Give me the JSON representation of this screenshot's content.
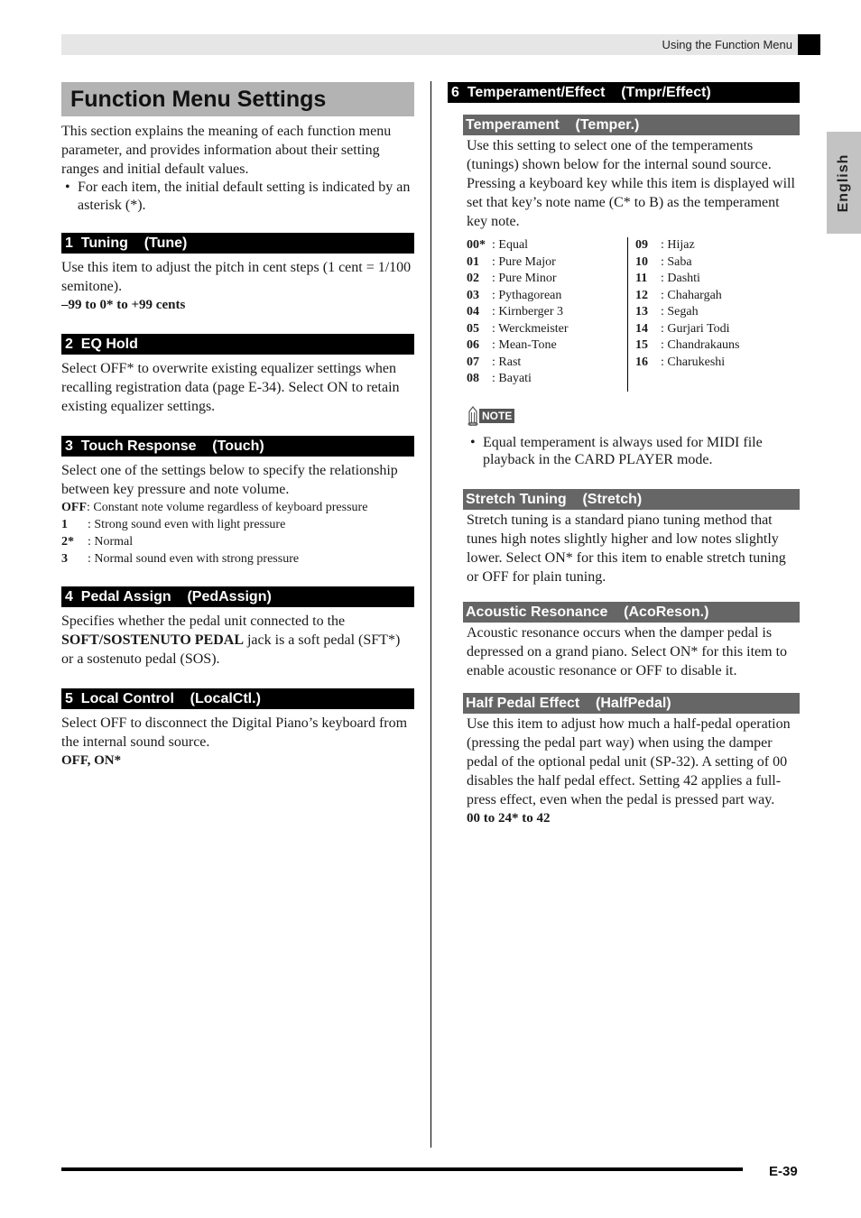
{
  "header": {
    "running_title": "Using the Function Menu"
  },
  "language_tab": "English",
  "page_title": "Function Menu Settings",
  "intro": {
    "paragraph": "This section explains the meaning of each function menu parameter, and provides information about their setting ranges and initial default values.",
    "bullet": "For each item, the initial default setting is indicated by an asterisk (*)."
  },
  "sections": {
    "tuning": {
      "heading": "1  Tuning    (Tune)",
      "body": "Use this item to adjust the pitch in cent steps (1 cent = 1/100 semitone).",
      "range": "–99 to 0* to +99 cents"
    },
    "eq_hold": {
      "heading": "2  EQ Hold",
      "body": "Select OFF* to overwrite existing equalizer settings when recalling registration data (page E-34). Select ON to retain existing equalizer settings."
    },
    "touch": {
      "heading": "3  Touch Response    (Touch)",
      "body": "Select one of the settings below to specify the relationship between key pressure and note volume.",
      "options": [
        {
          "key": "OFF",
          "desc": ": Constant note volume regardless of keyboard pressure"
        },
        {
          "key": "1",
          "desc": ": Strong sound even with light pressure"
        },
        {
          "key": "2*",
          "desc": ": Normal"
        },
        {
          "key": "3",
          "desc": ": Normal sound even with strong pressure"
        }
      ]
    },
    "pedal_assign": {
      "heading": "4  Pedal Assign    (PedAssign)",
      "body_pre": "Specifies whether the pedal unit connected to the ",
      "body_bold": "SOFT/SOSTENUTO PEDAL",
      "body_post": " jack is a soft pedal (SFT*) or a sostenuto pedal (SOS)."
    },
    "local_control": {
      "heading": "5  Local Control    (LocalCtl.)",
      "body": "Select OFF to disconnect the Digital Piano’s keyboard from the internal sound source.",
      "range": "OFF, ON*"
    },
    "temperament_effect": {
      "heading": "6  Temperament/Effect    (Tmpr/Effect)",
      "temperament": {
        "heading": "Temperament    (Temper.)",
        "body": "Use this setting to select one of the temperaments (tunings) shown below for the internal sound source. Pressing a keyboard key while this item is displayed will set that key’s note name (C* to B) as the temperament key note.",
        "list_a": [
          {
            "num": "00*",
            "name": ": Equal"
          },
          {
            "num": "01",
            "name": ": Pure Major"
          },
          {
            "num": "02",
            "name": ": Pure Minor"
          },
          {
            "num": "03",
            "name": ": Pythagorean"
          },
          {
            "num": "04",
            "name": ": Kirnberger 3"
          },
          {
            "num": "05",
            "name": ": Werckmeister"
          },
          {
            "num": "06",
            "name": ": Mean-Tone"
          },
          {
            "num": "07",
            "name": ": Rast"
          },
          {
            "num": "08",
            "name": ": Bayati"
          }
        ],
        "list_b": [
          {
            "num": "09",
            "name": ": Hijaz"
          },
          {
            "num": "10",
            "name": ": Saba"
          },
          {
            "num": "11",
            "name": ": Dashti"
          },
          {
            "num": "12",
            "name": ": Chahargah"
          },
          {
            "num": "13",
            "name": ": Segah"
          },
          {
            "num": "14",
            "name": ": Gurjari Todi"
          },
          {
            "num": "15",
            "name": ": Chandrakauns"
          },
          {
            "num": "16",
            "name": ": Charukeshi"
          }
        ],
        "note_label": "NOTE",
        "note_bullet": "Equal temperament is always used for MIDI file playback in the CARD PLAYER mode."
      },
      "stretch": {
        "heading": "Stretch Tuning    (Stretch)",
        "body": "Stretch tuning is a standard piano tuning method that tunes high notes slightly higher and low notes slightly lower. Select ON* for this item to enable stretch tuning or OFF for plain tuning."
      },
      "acoustic": {
        "heading": "Acoustic Resonance    (AcoReson.)",
        "body": "Acoustic resonance occurs when the damper pedal is depressed on a grand piano. Select ON* for this item to enable acoustic resonance or OFF to disable it."
      },
      "half_pedal": {
        "heading": "Half Pedal Effect    (HalfPedal)",
        "body": "Use this item to adjust how much a half-pedal operation (pressing the pedal part way) when using the damper pedal of the optional pedal unit (SP-32). A setting of 00 disables the half pedal effect. Setting 42 applies a full-press effect, even when the pedal is pressed part way.",
        "range": "00 to 24* to 42"
      }
    }
  },
  "footer": {
    "page_number": "E-39"
  },
  "colors": {
    "heading_black": "#000000",
    "heading_gray": "#666666",
    "title_band": "#b3b3b3",
    "top_band": "#e6e6e6",
    "language_tab": "#c3c3c3"
  }
}
